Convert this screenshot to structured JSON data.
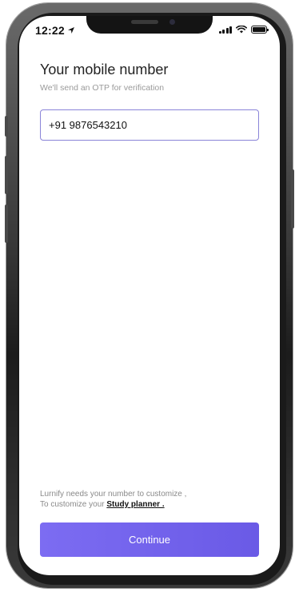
{
  "status_bar": {
    "time": "12:22",
    "location_icon": "location-arrow-icon",
    "signal_icon": "cellular-signal-icon",
    "wifi_icon": "wifi-icon",
    "battery_icon": "battery-icon"
  },
  "main": {
    "title": "Your mobile number",
    "subtitle": "We'll send an OTP for verification",
    "phone_value": "+91 9876543210"
  },
  "footer": {
    "note_line1": "Lurnify needs your number to customize ,",
    "note_line2_prefix": "To customize your ",
    "planner_link": "Study planner .",
    "continue_label": "Continue"
  },
  "colors": {
    "accent": "#6f60ec",
    "input_border": "#8a84d8"
  }
}
